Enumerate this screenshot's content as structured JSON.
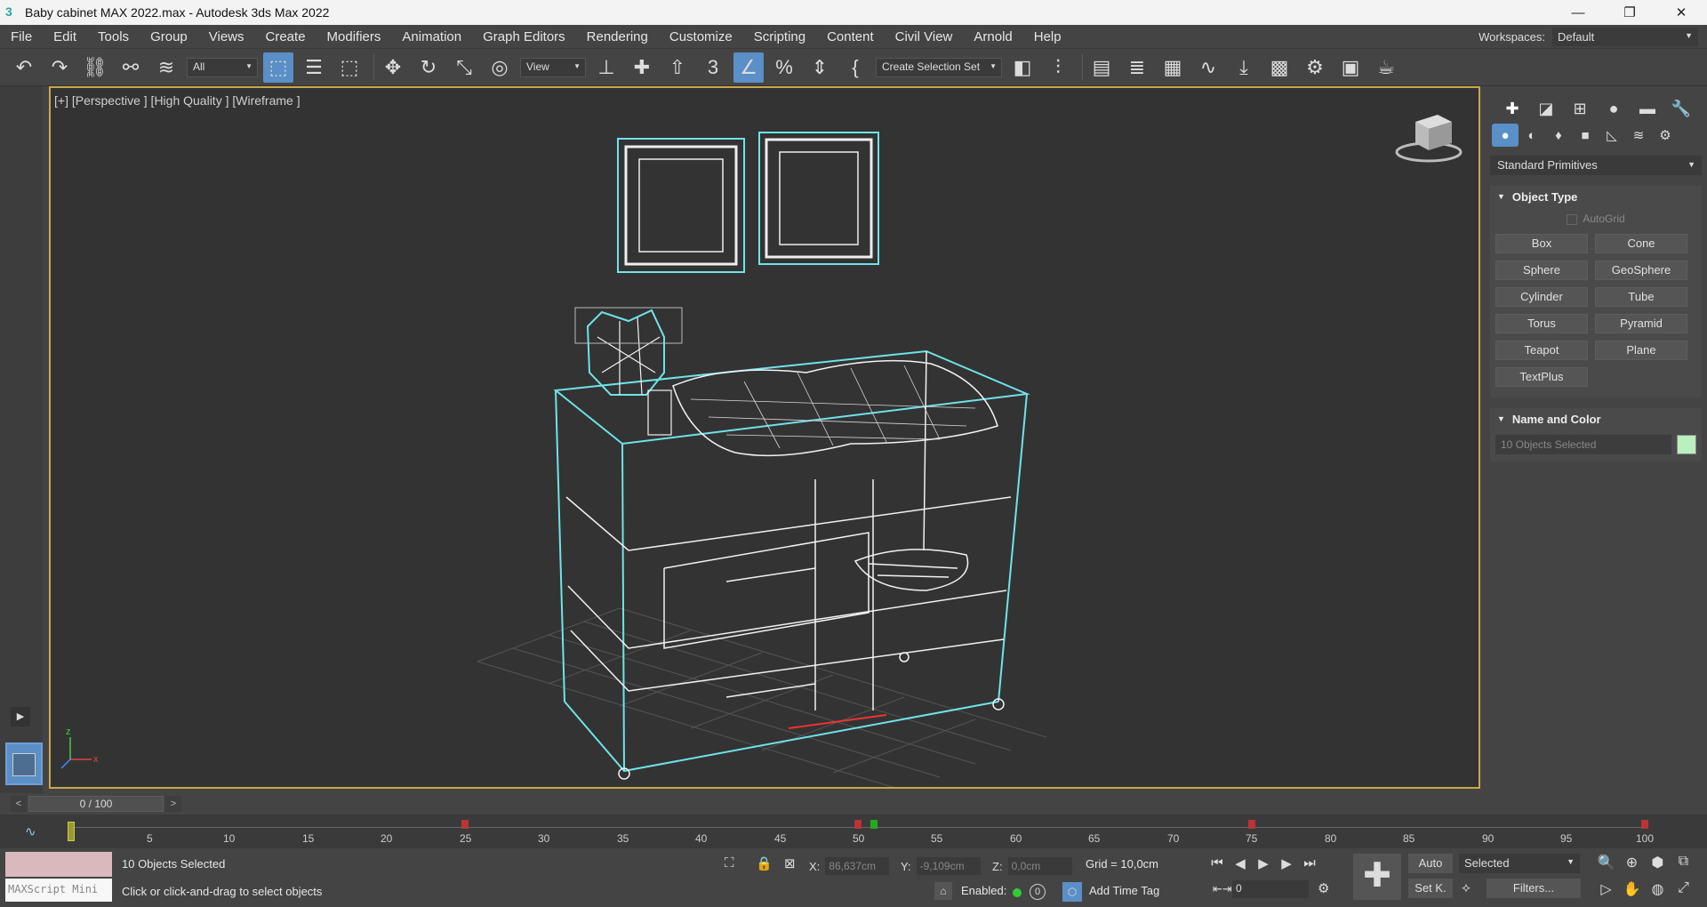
{
  "window": {
    "title": "Baby cabinet MAX 2022.max - Autodesk 3ds Max 2022",
    "app_icon": "3ds-max-icon",
    "minimize": "—",
    "maximize": "❐",
    "close": "✕"
  },
  "menu": [
    "File",
    "Edit",
    "Tools",
    "Group",
    "Views",
    "Create",
    "Modifiers",
    "Animation",
    "Graph Editors",
    "Rendering",
    "Customize",
    "Scripting",
    "Content",
    "Civil View",
    "Arnold",
    "Help"
  ],
  "workspaces": {
    "label": "Workspaces:",
    "value": "Default"
  },
  "toolbar": {
    "filter": "All",
    "ref_coord": "View",
    "selection_set": "Create Selection Set"
  },
  "viewport": {
    "label": "[+] [Perspective ] [High Quality ] [Wireframe ]"
  },
  "command_panel": {
    "category": "Standard Primitives",
    "object_type": {
      "title": "Object Type",
      "autogrid": "AutoGrid",
      "buttons": [
        "Box",
        "Cone",
        "Sphere",
        "GeoSphere",
        "Cylinder",
        "Tube",
        "Torus",
        "Pyramid",
        "Teapot",
        "Plane",
        "TextPlus"
      ]
    },
    "name_and_color": {
      "title": "Name and Color",
      "name_value": "10 Objects Selected",
      "color": "#b9f0c0"
    }
  },
  "timeline": {
    "frame_display": "0 / 100",
    "prev": "<",
    "next": ">",
    "ticks": [
      "5",
      "10",
      "15",
      "20",
      "25",
      "30",
      "35",
      "40",
      "45",
      "50",
      "55",
      "60",
      "65",
      "70",
      "75",
      "80",
      "85",
      "90",
      "95",
      "100"
    ]
  },
  "status": {
    "maxscript": "MAXScript Mini",
    "selection": "10 Objects Selected",
    "prompt": "Click or click-and-drag to select objects",
    "x_label": "X:",
    "x_value": "86,637cm",
    "y_label": "Y:",
    "y_value": "-9,109cm",
    "z_label": "Z:",
    "z_value": "0,0cm",
    "grid": "Grid = 10,0cm",
    "enabled_label": "Enabled:",
    "add_time_tag": "Add Time Tag",
    "auto": "Auto",
    "set_key": "Set K.",
    "key_filter": "Selected",
    "filters": "Filters...",
    "frame_field": "0"
  },
  "colors": {
    "accent": "#5a8fc7",
    "viewport_border": "#c8a84a",
    "selection_wire": "#6fe3e8"
  }
}
